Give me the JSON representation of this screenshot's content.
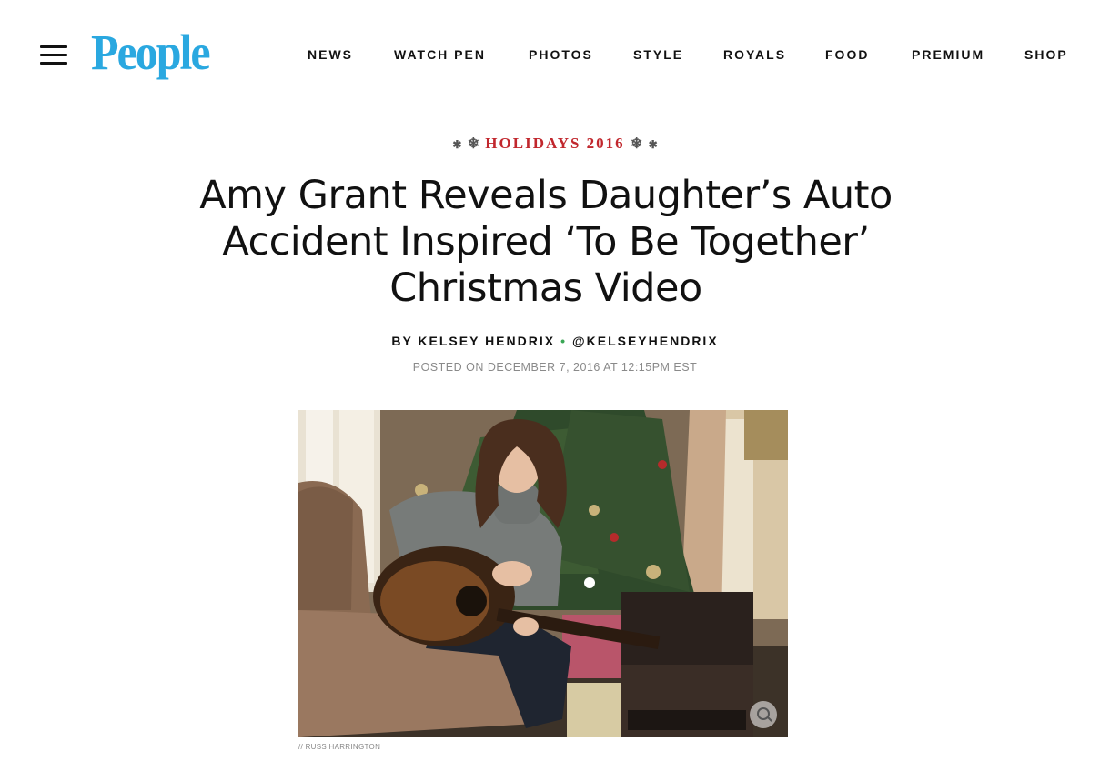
{
  "header": {
    "logo_text": "People",
    "brand_color": "#2aa8e0",
    "menu_icon": "hamburger-menu-icon",
    "nav": [
      {
        "label": "NEWS"
      },
      {
        "label": "WATCH PEN"
      },
      {
        "label": "PHOTOS"
      },
      {
        "label": "STYLE"
      },
      {
        "label": "ROYALS"
      },
      {
        "label": "FOOD"
      },
      {
        "label": "PREMIUM"
      },
      {
        "label": "SHOP"
      }
    ]
  },
  "article": {
    "kicker": "HOLIDAYS 2016",
    "kicker_color": "#c1272d",
    "headline": "Amy Grant Reveals Daughter’s Auto Accident Inspired ‘To Be Together’ Christmas Video",
    "byline_author": "BY KELSEY HENDRIX",
    "byline_handle": "@KELSEYHENDRIX",
    "posted": "POSTED ON DECEMBER 7, 2016 AT 12:15PM EST",
    "image_alt": "Amy Grant with guitar in front of Christmas tree",
    "image_icon": "zoom-icon",
    "credit": "// RUSS HARRINGTON"
  }
}
